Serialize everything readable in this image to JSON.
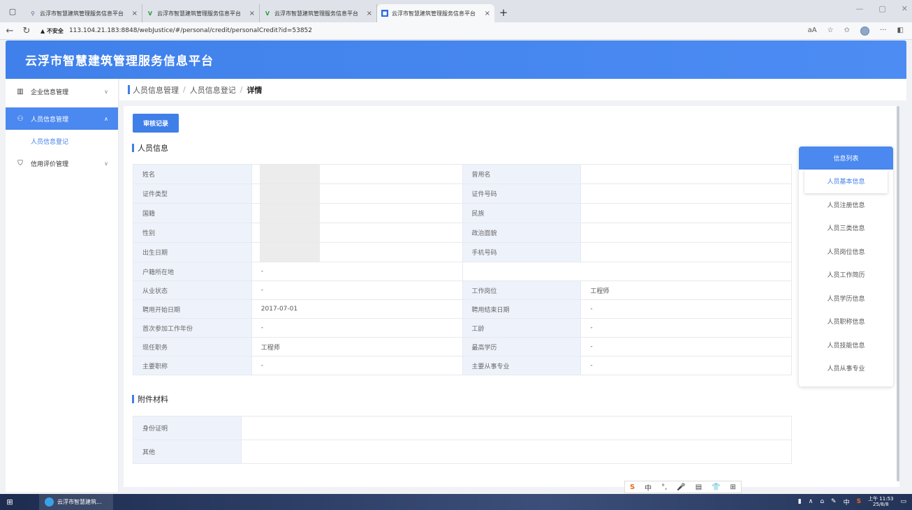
{
  "browser": {
    "tabs": [
      {
        "title": "云浮市智慧建筑管理服务信息平台",
        "favicon": "search-icon"
      },
      {
        "title": "云浮市智慧建筑管理服务信息平台",
        "favicon": "green-v-icon"
      },
      {
        "title": "云浮市智慧建筑管理服务信息平台",
        "favicon": "green-v-icon"
      },
      {
        "title": "云浮市智慧建筑管理服务信息平台",
        "favicon": "blue-app-icon"
      }
    ],
    "security_label": "▲ 不安全",
    "url": "113.104.21.183:8848/webJustice/#/personal/credit/personalCredit?id=53852"
  },
  "app": {
    "title": "云浮市智慧建筑管理服务信息平台"
  },
  "sidebar": {
    "items": [
      {
        "label": "企业信息管理",
        "icon": "building-icon"
      },
      {
        "label": "人员信息管理",
        "icon": "users-icon"
      },
      {
        "label": "人员信息登记",
        "icon": ""
      },
      {
        "label": "信用评价管理",
        "icon": "shield-icon"
      }
    ]
  },
  "breadcrumb": {
    "level1": "人员信息管理",
    "level2": "人员信息登记",
    "current": "详情"
  },
  "main": {
    "audit_button": "审核记录",
    "person_section_title": "人员信息",
    "attachment_section_title": "附件材料",
    "rows": [
      {
        "l1": "姓名",
        "v1": "",
        "l2": "曾用名",
        "v2": ""
      },
      {
        "l1": "证件类型",
        "v1": "",
        "l2": "证件号码",
        "v2": ""
      },
      {
        "l1": "国籍",
        "v1": "",
        "l2": "民族",
        "v2": ""
      },
      {
        "l1": "性别",
        "v1": "",
        "l2": "政治面貌",
        "v2": ""
      },
      {
        "l1": "出生日期",
        "v1": "",
        "l2": "手机号码",
        "v2": ""
      },
      {
        "l1": "户籍所在地",
        "v1": "-",
        "l2": "",
        "v2": ""
      },
      {
        "l1": "从业状态",
        "v1": "-",
        "l2": "工作岗位",
        "v2": "工程师"
      },
      {
        "l1": "聘用开始日期",
        "v1": "2017-07-01",
        "l2": "聘用结束日期",
        "v2": "-"
      },
      {
        "l1": "首次参加工作年份",
        "v1": "-",
        "l2": "工龄",
        "v2": "-"
      },
      {
        "l1": "现任职务",
        "v1": "工程师",
        "l2": "最高学历",
        "v2": "-"
      },
      {
        "l1": "主要职称",
        "v1": "-",
        "l2": "主要从事专业",
        "v2": "-"
      }
    ],
    "attachments": [
      {
        "label": "身份证明",
        "value": ""
      },
      {
        "label": "其他",
        "value": ""
      }
    ]
  },
  "info_list": {
    "header": "信息列表",
    "items": [
      "人员基本信息",
      "人员注册信息",
      "人员三类信息",
      "人员岗位信息",
      "人员工作简历",
      "人员学历信息",
      "人员职称信息",
      "人员技能信息",
      "人员从事专业"
    ]
  },
  "ime": {
    "chars": [
      "中",
      "°,",
      "🎤",
      "▤",
      "👕",
      "⊞"
    ]
  },
  "taskbar": {
    "app_label": "云浮市智慧建筑...",
    "time": "上午 11:53",
    "date": "25/8/8",
    "ime_indicator": "中"
  },
  "colors": {
    "primary": "#3f7fe8",
    "header": "#4b88ef"
  }
}
